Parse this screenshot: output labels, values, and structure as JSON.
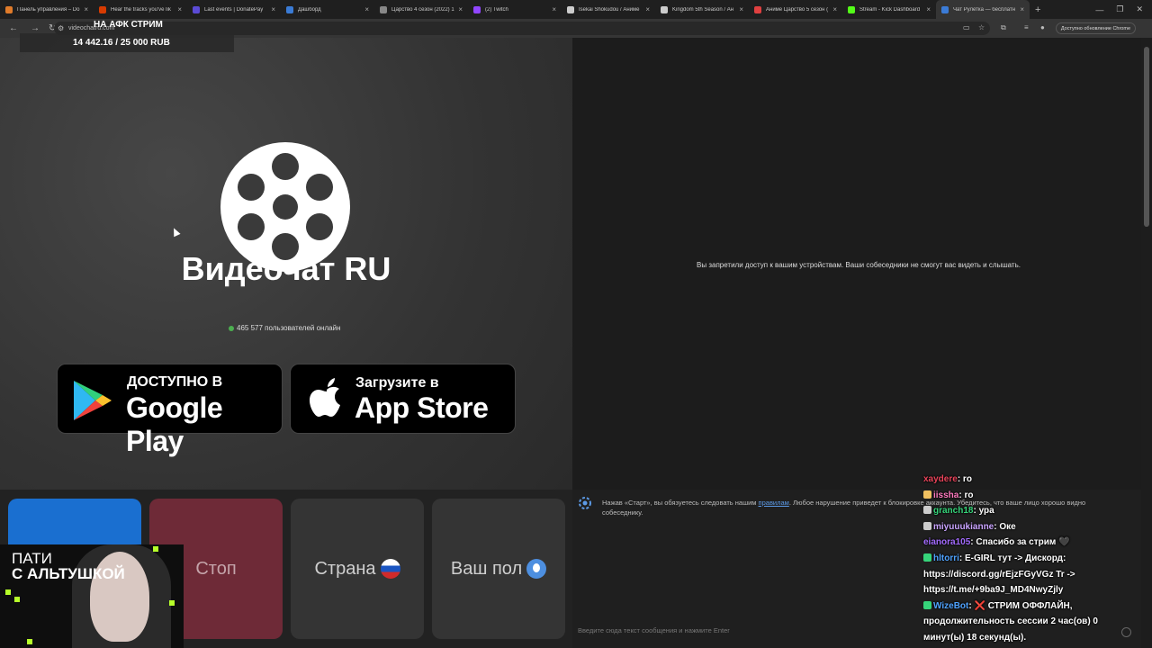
{
  "browser": {
    "tabs": [
      {
        "title": "Панель управления – Do",
        "color": "#e07b2a",
        "active": false
      },
      {
        "title": "Hear the tracks you've lik",
        "color": "#d83b01",
        "active": false
      },
      {
        "title": "Last events | DonatePay",
        "color": "#5b4bd6",
        "active": false
      },
      {
        "title": "Дашборд",
        "color": "#3a7bd5",
        "active": false
      },
      {
        "title": "Царство 4 сезон (2022) 1",
        "color": "#888888",
        "active": false
      },
      {
        "title": "(2) Twitch",
        "color": "#9146ff",
        "active": false
      },
      {
        "title": "Isekai Shokudou / Аниме",
        "color": "#cccccc",
        "active": false
      },
      {
        "title": "Kingdom 5th Season / Ан",
        "color": "#cccccc",
        "active": false
      },
      {
        "title": "Аниме Царство 5 сезон (",
        "color": "#e04040",
        "active": false
      },
      {
        "title": "Stream - Kick Dashboard",
        "color": "#53fc18",
        "active": false
      },
      {
        "title": "Чат Рулетка — бесплатн",
        "color": "#3b7bd6",
        "active": true
      }
    ],
    "new_tab": "+",
    "url": "videochatru.com",
    "update_label": "Доступно обновление Chrome"
  },
  "overlay": {
    "stream_title": "НА АФК СТРИМ",
    "donation_goal": "14 442.16 / 25 000 RUB",
    "cam_line1": "ПАТИ",
    "cam_line2": "С АЛЬТУШКОЙ"
  },
  "site": {
    "title": "Видеочат RU",
    "online_text": "465 577 пользователей онлайн",
    "google_play": {
      "small": "ДОСТУПНО В",
      "big": "Google Play"
    },
    "app_store": {
      "small": "Загрузите в",
      "big": "App Store"
    },
    "permission_message": "Вы запретили доступ к вашим устройствам. Ваши собеседники не смогут вас видеть и слышать.",
    "buttons": {
      "start": "",
      "stop": "Стоп",
      "country": "Страна",
      "gender": "Ваш пол"
    },
    "rules_text_before": "Нажав «Старт», вы обязуетесь следовать нашим ",
    "rules_link": "правилам",
    "rules_text_after": ". Любое нарушение приведет к блокировке аккаунта. Убедитесь, что ваше лицо хорошо видно собеседнику.",
    "message_placeholder": "Введите сюда текст сообщения и нажмите Enter"
  },
  "stream_chat": [
    {
      "user": "xaydere",
      "text": "ro",
      "badge": ""
    },
    {
      "user": "iissha",
      "text": "ro",
      "badge": "#f0c060"
    },
    {
      "user": "granch18",
      "text": "ура",
      "badge": "#cccccc"
    },
    {
      "user": "miyuuukianne",
      "text": "Оке",
      "badge": "#cccccc"
    },
    {
      "user": "eianora105",
      "text": "Спасибо за стрим 🖤",
      "badge": ""
    },
    {
      "user": "hltorri",
      "text": "E-GIRL тут -> Дискорд: https://discord.gg/rEjzFGyVGz Tr -> https://t.me/+9ba9J_MD4NwyZjly",
      "badge": "#36d47a"
    },
    {
      "user": "WizeBot",
      "text": "❌ СТРИМ ОФФЛАЙН, продолжительность сессии 2 час(ов) 0 минут(ы) 18 секунд(ы).",
      "badge": "#36d47a"
    }
  ]
}
